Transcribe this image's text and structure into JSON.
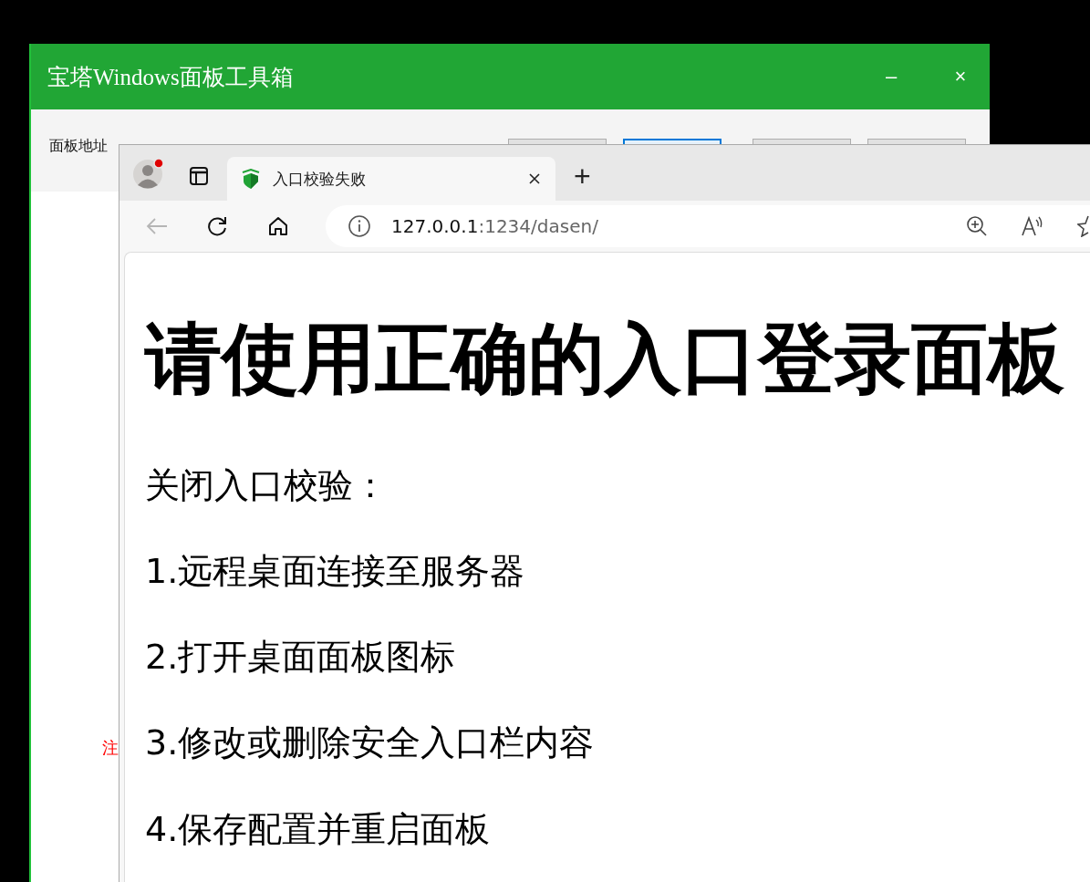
{
  "back_window": {
    "title": "宝塔Windows面板工具箱",
    "window_buttons": [
      "–",
      "×"
    ],
    "address_label": "面板地址",
    "toolbar_buttons": [
      {
        "selected": false
      },
      {
        "selected": true
      },
      {
        "selected": false
      },
      {
        "selected": false
      }
    ],
    "note_text": "注"
  },
  "browser": {
    "profile_notification": true,
    "tabs": [
      {
        "title": "入口校验失败",
        "selected": true
      }
    ],
    "new_tab": "+",
    "back_disabled": true,
    "address": {
      "host": "127.0.0.1",
      "rest": ":1234/dasen/"
    },
    "page": {
      "heading": "请使用正确的入口登录面板",
      "paragraphs": [
        "关闭入口校验：",
        "1.远程桌面连接至服务器",
        "2.打开桌面面板图标",
        "3.修改或删除安全入口栏内容",
        "4.保存配置并重启面板"
      ]
    }
  }
}
